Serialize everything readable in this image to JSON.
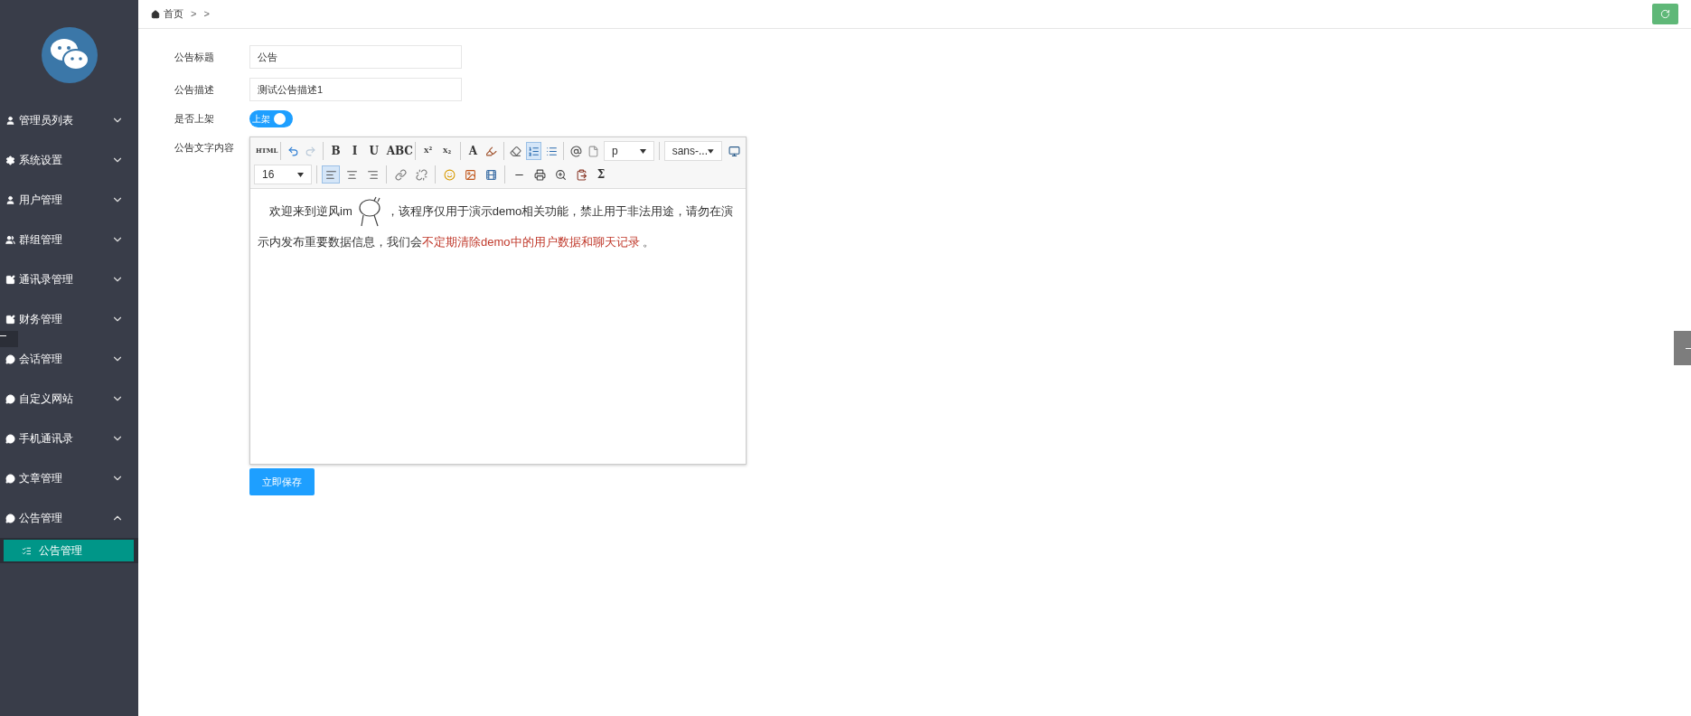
{
  "breadcrumb": {
    "home": "首页",
    "separators": [
      ">",
      ">"
    ]
  },
  "sidebar": {
    "items": [
      {
        "label": "管理员列表",
        "expanded": false
      },
      {
        "label": "系统设置",
        "expanded": false
      },
      {
        "label": "用户管理",
        "expanded": false
      },
      {
        "label": "群组管理",
        "expanded": false
      },
      {
        "label": "通讯录管理",
        "expanded": false
      },
      {
        "label": "财务管理",
        "expanded": false
      },
      {
        "label": "会话管理",
        "expanded": false
      },
      {
        "label": "自定义网站",
        "expanded": false
      },
      {
        "label": "手机通讯录",
        "expanded": false
      },
      {
        "label": "文章管理",
        "expanded": false
      },
      {
        "label": "公告管理",
        "expanded": true,
        "children": [
          {
            "label": "公告管理",
            "selected": true
          }
        ]
      }
    ]
  },
  "form": {
    "title_label": "公告标题",
    "title_value": "公告",
    "desc_label": "公告描述",
    "desc_value": "测试公告描述1",
    "publish_label": "是否上架",
    "publish_toggle": {
      "label": "上架",
      "on": true
    },
    "content_label": "公告文字内容"
  },
  "editor": {
    "toolbar_rows": [
      [
        {
          "kind": "text",
          "label": "HTML",
          "selected": false
        },
        {
          "kind": "sep"
        },
        {
          "kind": "icon",
          "selected": false
        },
        {
          "kind": "icon",
          "selected": false
        },
        {
          "kind": "sep"
        },
        {
          "kind": "text",
          "label": "B",
          "selected": false
        },
        {
          "kind": "text",
          "label": "I",
          "selected": false
        },
        {
          "kind": "text",
          "label": "U",
          "selected": false
        },
        {
          "kind": "text",
          "label": "ABC",
          "selected": false
        },
        {
          "kind": "sep"
        },
        {
          "kind": "text",
          "label": "X$^{2}$",
          "selected": false
        },
        {
          "kind": "text",
          "label": "X$_{2}$",
          "selected": false
        },
        {
          "kind": "sep"
        },
        {
          "kind": "text",
          "label": "A",
          "selected": false
        },
        {
          "kind": "icon",
          "selected": false
        },
        {
          "kind": "sep"
        },
        {
          "kind": "icon",
          "selected": false
        },
        {
          "kind": "icon",
          "selected": true
        },
        {
          "kind": "icon",
          "selected": false
        },
        {
          "kind": "sep"
        },
        {
          "kind": "icon",
          "selected": false
        },
        {
          "kind": "icon",
          "selected": false
        },
        {
          "kind": "select",
          "value": "p"
        },
        {
          "kind": "sep"
        },
        {
          "kind": "select",
          "value": "sans-..."
        },
        {
          "kind": "spacer"
        },
        {
          "kind": "icon",
          "selected": false
        }
      ],
      [
        {
          "kind": "select",
          "value": "16"
        },
        {
          "kind": "sep"
        },
        {
          "kind": "icon",
          "selected": true
        },
        {
          "kind": "icon",
          "selected": false
        },
        {
          "kind": "icon",
          "selected": false
        },
        {
          "kind": "sep"
        },
        {
          "kind": "icon",
          "selected": false
        },
        {
          "kind": "icon",
          "selected": false
        },
        {
          "kind": "sep"
        },
        {
          "kind": "icon",
          "selected": false
        },
        {
          "kind": "icon",
          "selected": false
        },
        {
          "kind": "icon",
          "selected": false
        },
        {
          "kind": "sep"
        },
        {
          "kind": "icon",
          "selected": false
        },
        {
          "kind": "icon",
          "selected": false
        },
        {
          "kind": "icon",
          "selected": false
        },
        {
          "kind": "icon",
          "selected": false
        },
        {
          "kind": "text",
          "label": "Σ",
          "selected": false
        }
      ]
    ],
    "content": [
      {
        "kind": "text",
        "text": "欢迎来到逆风im",
        "highlight": false
      },
      {
        "kind": "sticker"
      },
      {
        "kind": "text",
        "text": "，该程序仅用于演示demo相关功能，禁止用于非法用途，请勿在演示内发布重要数据信息，我们会",
        "highlight": false
      },
      {
        "kind": "text",
        "text": "不定期清除demo中的用户数据和聊天记录",
        "highlight": true
      },
      {
        "kind": "text",
        "text": " 。",
        "highlight": false
      }
    ]
  },
  "save_button": "立即保存"
}
